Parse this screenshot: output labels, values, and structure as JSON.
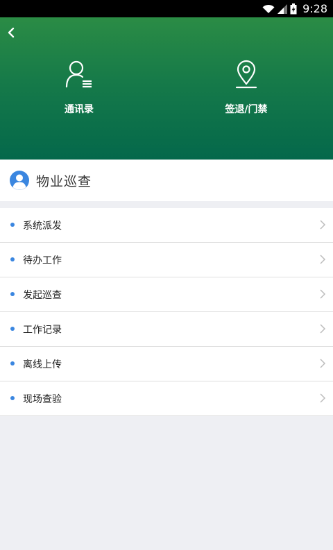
{
  "status_bar": {
    "time": "9:28",
    "icons": [
      "wifi-icon",
      "signal-icon",
      "battery-charging-icon"
    ]
  },
  "header": {
    "back_icon": "chevron-left-icon",
    "actions": [
      {
        "label": "通讯录",
        "icon": "contacts-icon"
      },
      {
        "label": "签退/门禁",
        "icon": "location-pin-icon"
      }
    ],
    "gradient_colors": [
      "#2b8c45",
      "#04684b"
    ]
  },
  "section": {
    "title": "物业巡查",
    "icon": "user-avatar-icon",
    "accent": "#3a86e0"
  },
  "menu": {
    "items": [
      {
        "label": "系统派发"
      },
      {
        "label": "待办工作"
      },
      {
        "label": "发起巡查"
      },
      {
        "label": "工作记录"
      },
      {
        "label": "离线上传"
      },
      {
        "label": "现场查验"
      }
    ]
  }
}
